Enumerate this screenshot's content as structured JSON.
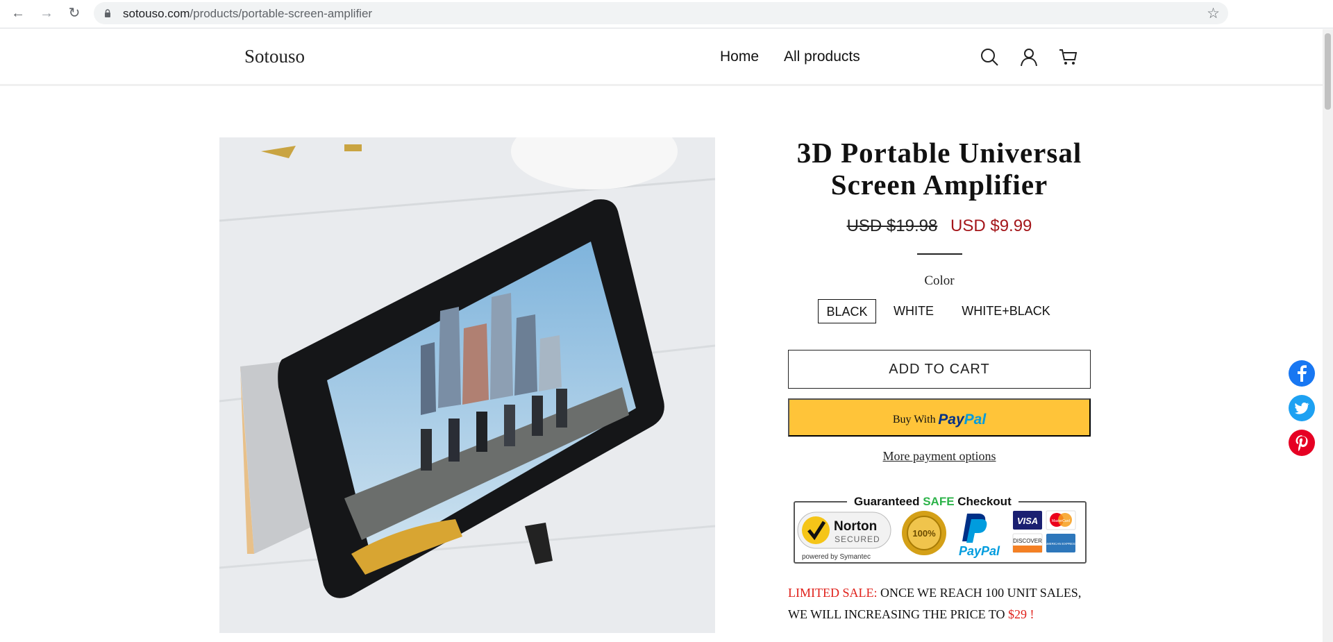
{
  "browser": {
    "url_domain": "sotouso.com",
    "url_path": "/products/portable-screen-amplifier"
  },
  "header": {
    "logo": "Sotouso",
    "nav": [
      "Home",
      "All products"
    ]
  },
  "product": {
    "title": "3D Portable Universal Screen Amplifier",
    "price_old": "USD $19.98",
    "price_new": "USD $9.99",
    "color_label": "Color",
    "colors": [
      "BLACK",
      "WHITE",
      "WHITE+BLACK"
    ],
    "selected_color": "BLACK",
    "add_to_cart": "ADD TO CART",
    "paypal_prefix": "Buy With",
    "paypal_pay": "Pay",
    "paypal_pal": "Pal",
    "more_payment": "More payment options"
  },
  "trust": {
    "title_prefix": "Guaranteed ",
    "title_safe": "SAFE",
    "title_suffix": " Checkout",
    "norton": "Norton",
    "norton_secured": "SECURED",
    "norton_by": "powered by Symantec",
    "guarantee": "100%",
    "paypal": "PayPal",
    "visa": "VISA",
    "mastercard": "MasterCard",
    "discover": "DISCOVER",
    "amex": "AMERICAN EXPRESS"
  },
  "sale": {
    "label": "LIMITED SALE:",
    "text": " ONCE WE REACH 100 UNIT SALES, WE WILL  INCREASING THE PRICE TO ",
    "price": "$29 !"
  },
  "colors": {
    "accent_red": "#a4161a",
    "paypal_yellow": "#ffc439",
    "facebook": "#1877f2",
    "twitter": "#1da1f2",
    "pinterest": "#e60023"
  },
  "icons": [
    "back-arrow-icon",
    "forward-arrow-icon",
    "reload-icon",
    "lock-icon",
    "bookmark-star-icon",
    "search-icon",
    "account-icon",
    "cart-icon",
    "facebook-icon",
    "twitter-icon",
    "pinterest-icon"
  ]
}
